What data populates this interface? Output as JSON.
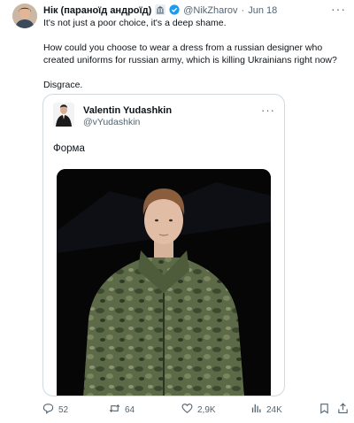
{
  "tweet": {
    "author_name": "Нік (параноїд андроїд)",
    "author_handle": "@NikZharov",
    "separator": "·",
    "date": "Jun 18",
    "more_label": "···",
    "paragraphs": [
      "It's not just a poor choice, it's a deep shame.",
      "How could you choose to wear a dress from a russian designer who created uniforms for russian army, which is killing Ukrainians right now?",
      "Disgrace."
    ]
  },
  "quoted": {
    "author_name": "Valentin Yudashkin",
    "author_handle": "@vYudashkin",
    "more_label": "···",
    "text": "Форма"
  },
  "actions": {
    "replies": "52",
    "reposts": "64",
    "likes": "2,9K",
    "views": "24K"
  },
  "icons": {
    "badge": "government-building-icon",
    "verified": "verified-check-icon",
    "reply": "speech-bubble-icon",
    "repost": "repost-arrows-icon",
    "like": "heart-icon",
    "views": "bar-chart-icon",
    "bookmark": "bookmark-icon",
    "share": "share-upload-icon"
  },
  "colors": {
    "text_primary": "#0f1419",
    "text_secondary": "#536471",
    "verified_blue": "#1d9bf0",
    "border": "#cfd9de"
  }
}
